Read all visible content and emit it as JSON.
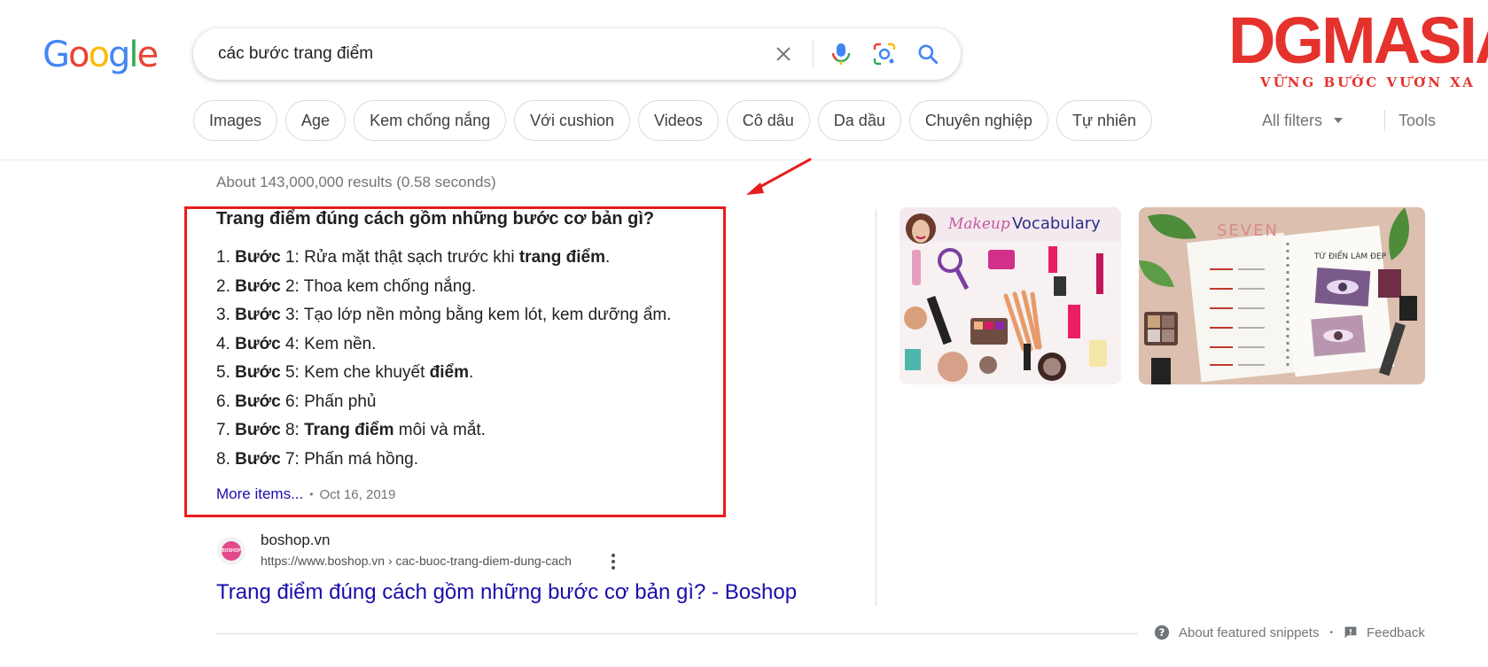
{
  "header": {
    "logo_letters": [
      "G",
      "o",
      "o",
      "g",
      "l",
      "e"
    ],
    "logo_colors": [
      "#4285F4",
      "#EA4335",
      "#FBBC05",
      "#4285F4",
      "#34A853",
      "#EA4335"
    ],
    "search_query": "các bước trang điểm",
    "icons": {
      "clear": "close-icon",
      "voice": "microphone-icon",
      "lens": "lens-camera-icon",
      "search": "search-icon"
    }
  },
  "brand": {
    "name": "DGMASIA",
    "tagline": "VỮNG BƯỚC VƯƠN XA",
    "color": "#e5322d"
  },
  "chips": [
    "Images",
    "Age",
    "Kem chống nắng",
    "Với cushion",
    "Videos",
    "Cô dâu",
    "Da dầu",
    "Chuyên nghiệp",
    "Tự nhiên"
  ],
  "tools": {
    "all_filters": "All filters",
    "tools": "Tools"
  },
  "results": {
    "stats": "About 143,000,000 results (0.58 seconds)",
    "featured_snippet": {
      "title": "Trang điểm đúng cách gồm những bước cơ bản gì?",
      "steps": [
        {
          "num": "1.",
          "bold": "Bước",
          "text": " 1: Rửa mặt thật sạch trước khi ",
          "bold2": "trang điểm",
          "after": "."
        },
        {
          "num": "2.",
          "bold": "Bước",
          "text": " 2: Thoa kem chống nắng.",
          "bold2": "",
          "after": ""
        },
        {
          "num": "3.",
          "bold": "Bước",
          "text": " 3: Tạo lớp nền mỏng bằng kem lót, kem dưỡng ẩm.",
          "bold2": "",
          "after": ""
        },
        {
          "num": "4.",
          "bold": "Bước",
          "text": " 4: Kem nền.",
          "bold2": "",
          "after": ""
        },
        {
          "num": "5.",
          "bold": "Bước",
          "text": " 5: Kem che khuyết ",
          "bold2": "điểm",
          "after": "."
        },
        {
          "num": "6.",
          "bold": "Bước",
          "text": " 6: Phấn phủ",
          "bold2": "",
          "after": ""
        },
        {
          "num": "7.",
          "bold": "Bước",
          "text": " 8: ",
          "bold2": "Trang điểm",
          "after": " môi và mắt."
        },
        {
          "num": "8.",
          "bold": "Bước",
          "text": " 7: Phấn má hồng.",
          "bold2": "",
          "after": ""
        }
      ],
      "more_items": "More items...",
      "separator": "•",
      "date": "Oct 16, 2019",
      "highlight_color": "#e81d1d"
    },
    "source": {
      "favicon_text": "BOSHOP",
      "site_name": "boshop.vn",
      "url": "https://www.boshop.vn › cac-buoc-trang-diem-dung-cach",
      "title": "Trang điểm đúng cách gồm những bước cơ bản gì? - Boshop"
    },
    "images": [
      {
        "title": "Makeup Vocabulary"
      },
      {
        "title": "SEVEN",
        "subtitle": "TỪ ĐIỂN LÀM ĐẸP"
      }
    ]
  },
  "footer": {
    "about": "About featured snippets",
    "separator": "•",
    "feedback": "Feedback"
  }
}
